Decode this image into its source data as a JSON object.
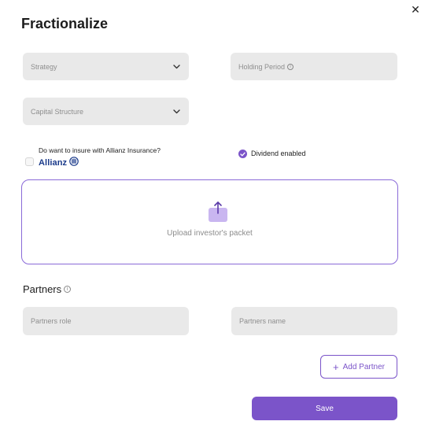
{
  "modal": {
    "title": "Fractionalize",
    "close_icon": "close-icon"
  },
  "fields": {
    "strategy": {
      "placeholder": "Strategy"
    },
    "holding_period": {
      "placeholder": "Holding Period"
    },
    "capital_structure": {
      "placeholder": "Capital Structure"
    }
  },
  "insurance": {
    "question": "Do want to insure with Allianz Insurance?",
    "brand": "Allianz",
    "checked": false
  },
  "dividend": {
    "label": "Dividend enabled",
    "checked": true
  },
  "upload": {
    "label": "Upload investor's packet",
    "icon": "upload-icon"
  },
  "partners": {
    "heading": "Partners",
    "role_placeholder": "Partners role",
    "name_placeholder": "Partners name",
    "add_label": "Add Partner"
  },
  "actions": {
    "save_label": "Save"
  },
  "colors": {
    "accent": "#7b54c9",
    "field_bg": "#e9e9e9",
    "allianz_blue": "#1a3a8a"
  }
}
